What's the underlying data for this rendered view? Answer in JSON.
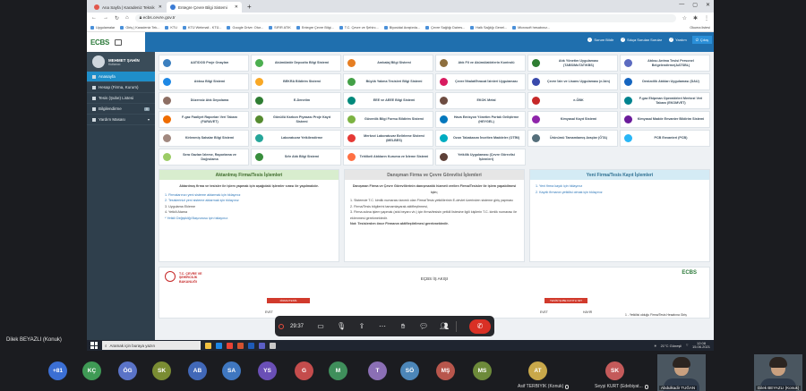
{
  "browser": {
    "tabs": [
      {
        "label": "Ana Sayfa | Karadeniz Teknik Ün..."
      },
      {
        "label": "Entegre Çevre Bilgi Sistemi"
      }
    ],
    "url": "ecbs.cevre.gov.tr",
    "bookmarks": [
      "Uygulamalar",
      "Giriş | Karadeniz Tek...",
      "KTU",
      "KTÜ Webmail - KTÜ...",
      "Google Drive: Otur...",
      "SIFIR ATIK",
      "Entegre Çevre Bilgi...",
      "T.C. Çevre ve Şehirc...",
      "Biyosidal Araştırıla...",
      "Çevre Sağlığı Daires...",
      "Halk Sağlığı Genel...",
      "Microsoft hesabınız..."
    ],
    "reading_list": "Okuma listesi"
  },
  "app": {
    "logo": "ECBS",
    "notif_count": "0",
    "header_buttons": {
      "faq": "Sorum Bildir",
      "support": "Sıkça Sorulan Sorular",
      "help": "Yardım",
      "exit": "Çıkış"
    },
    "user": {
      "name": "MEHMET ŞAHİN",
      "role": "Kullanıcı"
    },
    "sidebar": [
      {
        "label": "Anasayfa"
      },
      {
        "label": "Hesap (Firma, Kurum)"
      },
      {
        "label": "Tesis (Şube) Listesi"
      },
      {
        "label": "Bilgilendirme",
        "badge": "0"
      },
      {
        "label": "Yardım Masası"
      }
    ],
    "modules": [
      {
        "label": "AAT/DOD Proje Onayları",
        "color": "#3b7fbf"
      },
      {
        "label": "Akümülatör Depozito Bilgi Sistemi",
        "color": "#4caf50"
      },
      {
        "label": "Ambalaj Bilgi Sistemi",
        "color": "#e67e22"
      },
      {
        "label": "Atık Fil ve Akümülatörlerin Kontrolü",
        "color": "#8e6f3e"
      },
      {
        "label": "Atık Yönetim Uygulaması (TABS/MoTAT/KBS)",
        "color": "#2e7d32"
      },
      {
        "label": "Atıksu Arıtma Tesisi Personel Belgelendirme(AATSBL)",
        "color": "#5c6bc0"
      },
      {
        "label": "Atıksu Bilgi Sistemi",
        "color": "#1e88e5"
      },
      {
        "label": "BEKRA Bildirim Sistemi",
        "color": "#f9a825"
      },
      {
        "label": "Büyük Yakma Tesisleri Bilgi Sistemi",
        "color": "#43a047"
      },
      {
        "label": "Çevre İthalat/İhracat İzinleri Uygulaması",
        "color": "#d81b60"
      },
      {
        "label": "Çevre İzin ve Lisans Uygulaması (e-İzin)",
        "color": "#3949ab"
      },
      {
        "label": "Denizcilik Atıkları Uygulaması (DAU)",
        "color": "#1565c0"
      },
      {
        "label": "Düzensiz Atık Depolama",
        "color": "#8d6e63"
      },
      {
        "label": "E-Denetim",
        "color": "#2e7d32"
      },
      {
        "label": "EEE ve AEEE Bilgi Sistemi",
        "color": "#00897b"
      },
      {
        "label": "EKOK Metal",
        "color": "#6d4c41"
      },
      {
        "label": "e-ÖBK",
        "color": "#c62828"
      },
      {
        "label": "F-gaz Ekipman Operatörleri Merkezi Veri Tabanı (EKOMVET)",
        "color": "#00838f"
      },
      {
        "label": "F-gaz Faaliyet Raporları Veri Tabanı (FARAVET)",
        "color": "#ef6c00"
      },
      {
        "label": "Gönüllü Karbon Piyasası Proje Kayıt Sistemi",
        "color": "#558b2f"
      },
      {
        "label": "Güvenlik Bilgi Formu Bildirim Sistemi",
        "color": "#7cb342"
      },
      {
        "label": "Hava Emisyon Yönetim Portalı Geliştirme (HEYGEL)",
        "color": "#0277bd"
      },
      {
        "label": "Kimyasal Kayıt Sistemi",
        "color": "#8e24aa"
      },
      {
        "label": "Kimyasal Madde Envanter Bildirim Sistemi",
        "color": "#6a1b9a"
      },
      {
        "label": "Kirlenmiş Sahalar Bilgi Sistemi",
        "color": "#a1887f"
      },
      {
        "label": "Laboratuvar Yetkilendirme",
        "color": "#26a69a"
      },
      {
        "label": "Merkezi Laboratuvar Belirleme Sistemi (MELBES)",
        "color": "#e53935"
      },
      {
        "label": "Ozon Tabakasını İncelten Maddeler (OTİM)",
        "color": "#00acc1"
      },
      {
        "label": "Ürünümü Tamamlamış Araçlar (ÖTA)",
        "color": "#546e7a"
      },
      {
        "label": "PCB Envanteri (PCB)",
        "color": "#29b6f6"
      },
      {
        "label": "Sera Gazları İzleme, Raporlama ve Doğrulama",
        "color": "#9ccc65"
      },
      {
        "label": "Sıfır Atık Bilgi Sistemi",
        "color": "#388e3c"
      },
      {
        "label": "Tehlikeli Atıkların Kuruma ve İzleme Sistemi",
        "color": "#ff7043"
      },
      {
        "label": "Yetkilik Uygulaması (Çevre Görevlisi İşlemleri)",
        "color": "#5d4037"
      }
    ],
    "panels": {
      "left": {
        "title": "Aktarılmış Firma/Tesis İşlemleri",
        "subtitle": "Aktarılmış firma ve tesisler ile işlem yapmak için aşağıdaki işlemler sırası ile yapılmalıdır.",
        "items": [
          "1. Firmalarınızı yeni sisteme aktarmak için tıklayınız",
          "2. Tesislerinizi yeni sisteme aktarmak için tıklayınız",
          "3. Uygulama Ekleme",
          "4. Yetkili Atama",
          "* Yetkili Değişikliği Başvurusu için tıklayınız."
        ]
      },
      "middle": {
        "title": "Danışman Firma ve Çevre Görevlisi İşlemleri",
        "subtitle": "Danışman Firma ve Çevre Görevlilerinin danışmanlık hizmeti verilen Firma/Tesisler ile işlem yapabilmesi için;",
        "items": [
          "1. Sistemde T.C. kimlik numarası tanımlı olan Firma/Tesis yetkililerinin E-devlet üzerinden sisteme giriş yapması",
          "2. Firma/Tesis bilgilerini tamamlayarak aktifleştirmesi,",
          "3. Firma adına işlem yapmak (atık beyanı vb.) için firma/tesisin yetkili listesine ilgili kişilerin T.C. kimlik numarası ile eklenmesi gerekmektedir."
        ],
        "note": "Not: Tesislerden önce Firmanın aktifleştirilmesi gerekmektedir."
      },
      "right": {
        "title": "Yeni Firma/Tesis Kayıt İşlemleri",
        "items": [
          "1. Yeni firma kaydı için tıklayınız",
          "2. Kayıtlı firmanın yetkilisi olmak için tıklayınız"
        ]
      }
    },
    "flow": {
      "title": "EÇBS İŞ AKIŞI",
      "ministry": "T.C. ÇEVRE VE ŞEHİRCİLİK BAKANLIĞI",
      "logo2": "ECBS",
      "left_box": "FİRMA/TESİS",
      "right_box": "TESİSİ ŞUBE KAYITLI MI?",
      "evet": "EVET",
      "hayir": "HAYIR",
      "note": "1 - Yetkilisi olduğu Firma/Tesis Hesabına Giriş"
    }
  },
  "call": {
    "timer": "29:37",
    "presenter": "Dilek BEYAZLI (Konuk)",
    "participants": [
      {
        "initials": "+81",
        "color": "#3b6fd4"
      },
      {
        "initials": "KÇ",
        "color": "#3f9a55"
      },
      {
        "initials": "ÖG",
        "color": "#5a73c7"
      },
      {
        "initials": "SK",
        "color": "#7a8c33"
      },
      {
        "initials": "AB",
        "color": "#4168b8"
      },
      {
        "initials": "SA",
        "color": "#3f77c0"
      },
      {
        "initials": "YS",
        "color": "#6a4fb6"
      },
      {
        "initials": "G",
        "color": "#c44c4c"
      },
      {
        "initials": "M",
        "color": "#3f8f5b"
      },
      {
        "initials": "T",
        "color": "#8b6fb5"
      },
      {
        "initials": "SÖ",
        "color": "#4c86b8"
      },
      {
        "initials": "MŞ",
        "color": "#b8564c"
      },
      {
        "initials": "MS",
        "color": "#6d8a3a"
      },
      {
        "initials": "AT",
        "color": "#c9a84a",
        "name": "Asif TERBIYIK (Konuk)"
      },
      {
        "initials": "SK",
        "color": "#c45a5a",
        "name": "Seyşi KURT (Edebiyat..."
      }
    ],
    "video_tiles": [
      {
        "name": "Abdulkadir TUĞAN"
      },
      {
        "name": "Dilek BEYAZLI (Konuk)"
      }
    ]
  },
  "taskbar": {
    "search_placeholder": "Aramak için buraya yazın",
    "weather": "21°C Güneşli",
    "time": "12:08",
    "date": "15.06.2021"
  }
}
